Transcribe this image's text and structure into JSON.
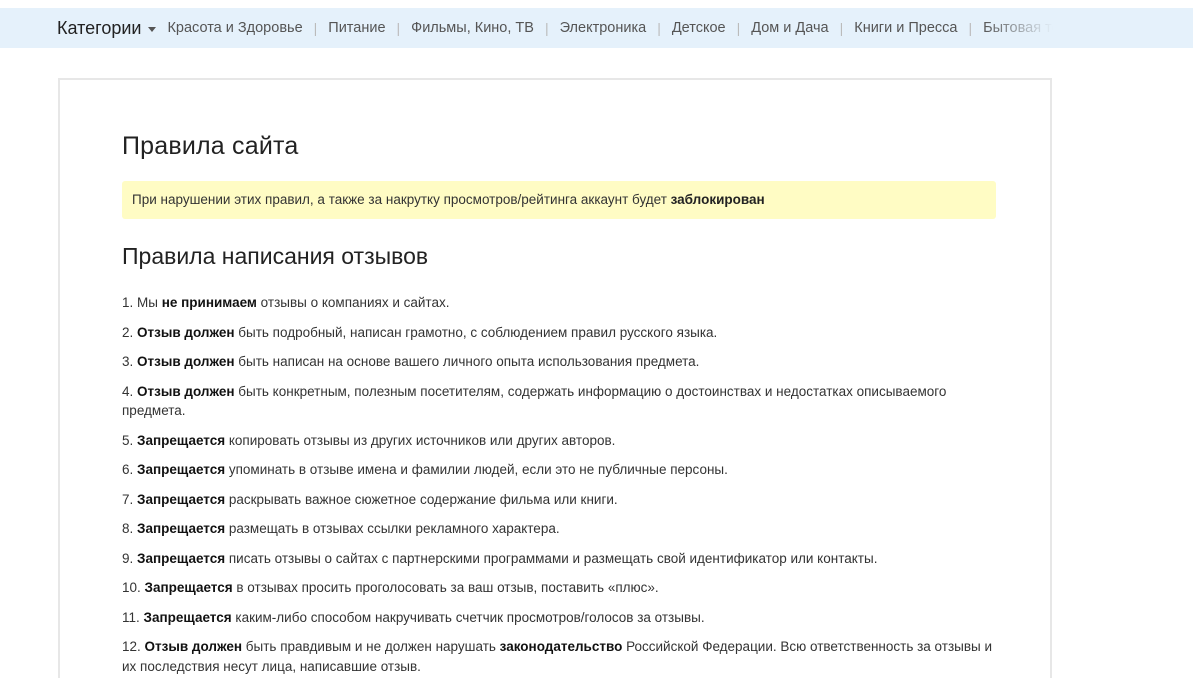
{
  "nav": {
    "categories_label": "Категории",
    "items": [
      {
        "label": "Красота и Здоровье"
      },
      {
        "label": "Питание"
      },
      {
        "label": "Фильмы, Кино, ТВ"
      },
      {
        "label": "Электроника"
      },
      {
        "label": "Детское"
      },
      {
        "label": "Дом и Дача"
      },
      {
        "label": "Книги и Пресса"
      },
      {
        "label": "Бытовая те"
      }
    ]
  },
  "page": {
    "title": "Правила сайта",
    "warning": {
      "text": "При нарушении этих правил, а также за накрутку просмотров/рейтинга аккаунт будет ",
      "bold": "заблокирован"
    },
    "section_title": "Правила написания отзывов",
    "rules": [
      {
        "num": "1. Мы ",
        "bold": "не принимаем",
        "rest": " отзывы о компаниях и сайтах."
      },
      {
        "num": "2. ",
        "bold": "Отзыв должен",
        "rest": " быть подробный, написан грамотно, с соблюдением правил русского языка."
      },
      {
        "num": "3. ",
        "bold": "Отзыв должен",
        "rest": " быть написан на основе вашего личного опыта использования предмета."
      },
      {
        "num": "4. ",
        "bold": "Отзыв должен",
        "rest": " быть конкретным, полезным посетителям, содержать информацию о достоинствах и недостатках описываемого предмета."
      },
      {
        "num": "5. ",
        "bold": "Запрещается",
        "rest": " копировать отзывы из других источников или других авторов."
      },
      {
        "num": "6. ",
        "bold": "Запрещается",
        "rest": " упоминать в отзыве имена и фамилии людей, если это не публичные персоны."
      },
      {
        "num": "7. ",
        "bold": "Запрещается",
        "rest": " раскрывать важное сюжетное содержание фильма или книги."
      },
      {
        "num": "8. ",
        "bold": "Запрещается",
        "rest": " размещать в отзывах ссылки рекламного характера."
      },
      {
        "num": "9. ",
        "bold": "Запрещается",
        "rest": " писать отзывы о сайтах с партнерскими программами и размещать свой идентификатор или контакты."
      },
      {
        "num": "10. ",
        "bold": "Запрещается",
        "rest": " в отзывах просить проголосовать за ваш отзыв, поставить «плюс»."
      },
      {
        "num": "11. ",
        "bold": "Запрещается",
        "rest": " каким-либо способом накручивать счетчик просмотров/голосов за отзывы."
      },
      {
        "num": "12. ",
        "bold": "Отзыв должен",
        "rest": " быть правдивым и не должен нарушать ",
        "bold2": "законодательство",
        "rest2": " Российской Федерации. Всю ответственность за отзывы и их последствия несут лица, написавшие отзыв."
      }
    ]
  },
  "colors": {
    "nav_background": "#e5f1fb",
    "warning_background": "#fffcc4",
    "panel_border": "#e7e7e7"
  }
}
